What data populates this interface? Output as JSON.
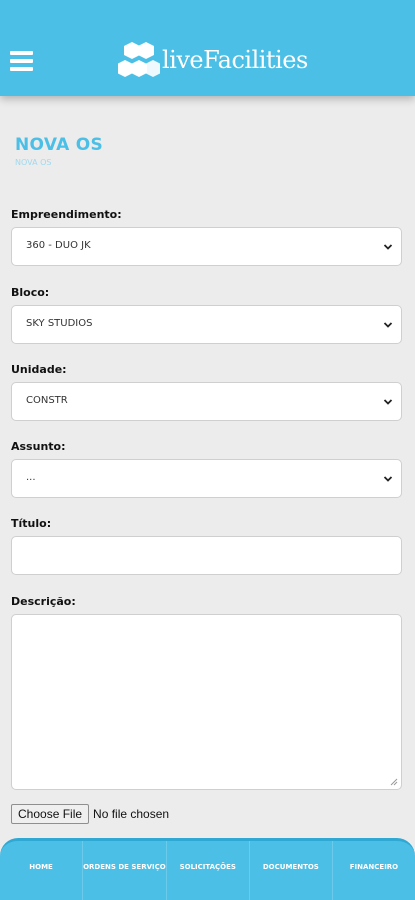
{
  "header": {
    "brand": "liveFacilities"
  },
  "page": {
    "title": "NOVA OS",
    "breadcrumb": "NOVA OS"
  },
  "form": {
    "empreendimento": {
      "label": "Empreendimento:",
      "value": "360 - DUO JK"
    },
    "bloco": {
      "label": "Bloco:",
      "value": "SKY STUDIOS"
    },
    "unidade": {
      "label": "Unidade:",
      "value": "CONSTR"
    },
    "assunto": {
      "label": "Assunto:",
      "value": "..."
    },
    "titulo": {
      "label": "Título:",
      "value": ""
    },
    "descricao": {
      "label": "Descrição:",
      "value": ""
    },
    "file": {
      "button": "Choose File",
      "status": "No file chosen"
    }
  },
  "nav": {
    "home": "HOME",
    "ordens": "ORDENS DE SERVIÇO",
    "solicitacoes": "SOLICITAÇÕES",
    "documentos": "DOCUMENTOS",
    "financeiro": "FINANCEIRO"
  },
  "colors": {
    "accent": "#4cbfe6",
    "background": "#ececec"
  }
}
